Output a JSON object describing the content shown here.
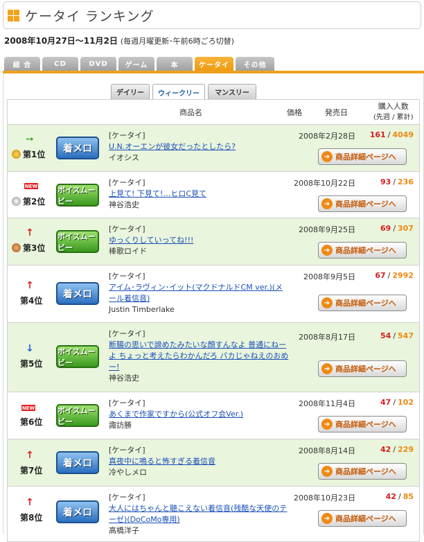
{
  "title": "ケータイ ランキング",
  "period": {
    "range": "2008年10月27日〜11月2日",
    "note": "(毎週月曜更新･午前6時ごろ切替)"
  },
  "category_tabs": [
    "総 合",
    "CD",
    "DVD",
    "ゲーム",
    "本",
    "ケータイ",
    "その他"
  ],
  "active_category": "ケータイ",
  "period_tabs": [
    "デイリー",
    "ウィークリー",
    "マンスリー"
  ],
  "table_header": {
    "name": "商品名",
    "price": "価格",
    "release": "発売日",
    "buyers": "購入人数",
    "buyers_sub": "(先週 / 累計)"
  },
  "detail_button_label": "商品詳細ページへ",
  "badges": {
    "chaku": "着メロ",
    "voice": "ボイスムービー"
  },
  "colors": {
    "accent": "#f0a020",
    "row_green": "#e9f5dc",
    "link": "#1a4fb8",
    "weekly": "#d42020",
    "total": "#ee8a10"
  },
  "rows": [
    {
      "rank": "第1位",
      "trend": "arrow-right",
      "medal": "gold",
      "badge": "着メロ",
      "badge_type": "blue",
      "category": "[ケータイ]",
      "title": "U.N.オーエンが彼女だったとしたら?",
      "artist": "イオシス",
      "date": "2008年2月28日",
      "weekly": "161",
      "total": "4049"
    },
    {
      "rank": "第2位",
      "trend": "new",
      "new_label": "NEW",
      "medal": "silver",
      "badge": "ボイスムービー",
      "badge_type": "green",
      "category": "[ケータイ]",
      "title": "上見て! 下見て!…ヒロC見て",
      "artist": "神谷浩史",
      "date": "2008年10月22日",
      "weekly": "93",
      "total": "236"
    },
    {
      "rank": "第3位",
      "trend": "arrow-up",
      "medal": "bronze",
      "badge": "ボイスムービー",
      "badge_type": "green",
      "category": "[ケータイ]",
      "title": "ゆっくりしていってね!!!",
      "artist": "棒歌ロイド",
      "date": "2008年9月25日",
      "weekly": "69",
      "total": "307"
    },
    {
      "rank": "第4位",
      "trend": "arrow-up",
      "badge": "着メロ",
      "badge_type": "blue",
      "category": "[ケータイ]",
      "title": "アイム･ラヴィン･イット(マクドナルドCM ver.)(メール着信音)",
      "artist": "Justin Timberlake",
      "date": "2008年9月5日",
      "weekly": "67",
      "total": "2992"
    },
    {
      "rank": "第5位",
      "trend": "arrow-down",
      "badge": "ボイスムービー",
      "badge_type": "green",
      "category": "[ケータイ]",
      "title": "断腸の思いで諦めたみたいな顔すんなよ 普通にねーよ ちょっと考えたらわかんだろ バカじゃねえのおめー!",
      "artist": "神谷浩史",
      "date": "2008年8月17日",
      "weekly": "54",
      "total": "547"
    },
    {
      "rank": "第6位",
      "trend": "new",
      "new_label": "NEW",
      "badge": "ボイスムービー",
      "badge_type": "green",
      "category": "[ケータイ]",
      "title": "あくまで作家ですから(公式オフ会Ver.)",
      "artist": "諏訪勝",
      "date": "2008年11月4日",
      "weekly": "47",
      "total": "102"
    },
    {
      "rank": "第7位",
      "trend": "arrow-up",
      "badge": "着メロ",
      "badge_type": "blue",
      "category": "[ケータイ]",
      "title": "真夜中に鳴ると怖すぎる着信音",
      "artist": "冷やしメロ",
      "date": "2008年8月14日",
      "weekly": "42",
      "total": "229"
    },
    {
      "rank": "第8位",
      "trend": "arrow-up",
      "badge": "着メロ",
      "badge_type": "blue",
      "category": "[ケータイ]",
      "title": "大人にはちゃんと聴こえない着信音(残酷な天使のテーゼ)(DoCoMo専用)",
      "artist": "高橋洋子",
      "date": "2008年10月23日",
      "weekly": "42",
      "total": "85"
    }
  ]
}
